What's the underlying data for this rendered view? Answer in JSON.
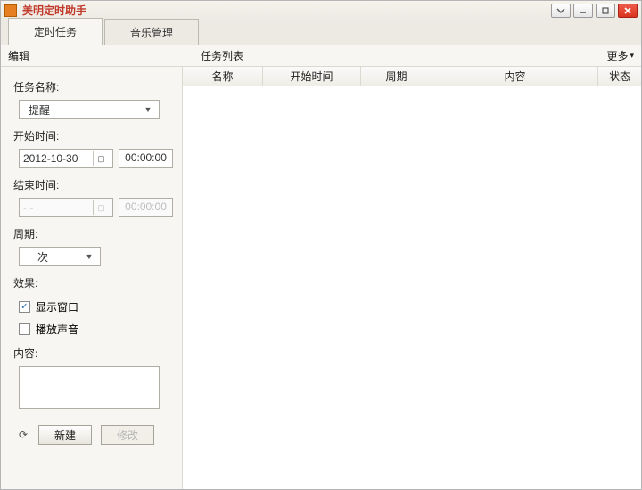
{
  "titlebar": {
    "title": "美明定时助手"
  },
  "tabs": {
    "scheduled": "定时任务",
    "music": "音乐管理"
  },
  "section": {
    "edit": "编辑",
    "list_title": "任务列表",
    "more": "更多"
  },
  "form": {
    "task_name_label": "任务名称:",
    "task_name_value": "提醒",
    "start_time_label": "开始时间:",
    "start_date": "2012-10-30",
    "start_time": "00:00:00",
    "end_time_label": "结束时间:",
    "end_date": "- -",
    "end_time": "00:00:00",
    "period_label": "周期:",
    "period_value": "一次",
    "effect_label": "效果:",
    "chk_show_window": "显示窗口",
    "chk_play_sound": "播放声音",
    "content_label": "内容:",
    "content_value": "",
    "btn_new": "新建",
    "btn_modify": "修改"
  },
  "table": {
    "cols": {
      "name": "名称",
      "start": "开始时间",
      "period": "周期",
      "content": "内容",
      "status": "状态"
    }
  }
}
